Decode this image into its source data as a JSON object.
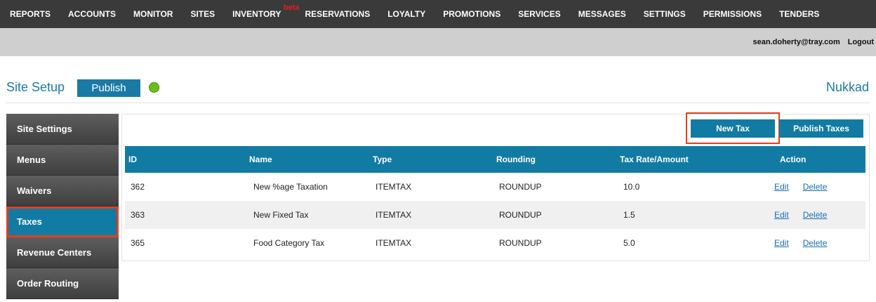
{
  "topnav": {
    "items": [
      "REPORTS",
      "ACCOUNTS",
      "MONITOR",
      "SITES",
      "INVENTORY",
      "RESERVATIONS",
      "LOYALTY",
      "PROMOTIONS",
      "SERVICES",
      "MESSAGES",
      "SETTINGS",
      "PERMISSIONS",
      "TENDERS"
    ],
    "beta_label": "beta"
  },
  "userbar": {
    "email": "sean.doherty@tray.com",
    "logout": "Logout"
  },
  "header": {
    "title": "Site Setup",
    "publish_label": "Publish",
    "site_name": "Nukkad",
    "status_color": "#6bbf1a"
  },
  "sidebar": {
    "items": [
      {
        "label": "Site Settings"
      },
      {
        "label": "Menus"
      },
      {
        "label": "Waivers"
      },
      {
        "label": "Taxes"
      },
      {
        "label": "Revenue Centers"
      },
      {
        "label": "Order Routing"
      }
    ],
    "active_index": 3
  },
  "actions": {
    "new_tax": "New Tax",
    "publish_taxes": "Publish Taxes"
  },
  "table": {
    "headers": [
      "ID",
      "Name",
      "Type",
      "Rounding",
      "Tax Rate/Amount",
      "Action"
    ],
    "rows": [
      {
        "id": "362",
        "name": "New %age Taxation",
        "type": "ITEMTAX",
        "rounding": "ROUNDUP",
        "rate": "10.0",
        "edit": "Edit",
        "delete": "Delete"
      },
      {
        "id": "363",
        "name": "New Fixed Tax",
        "type": "ITEMTAX",
        "rounding": "ROUNDUP",
        "rate": "1.5",
        "edit": "Edit",
        "delete": "Delete"
      },
      {
        "id": "365",
        "name": "Food Category Tax",
        "type": "ITEMTAX",
        "rounding": "ROUNDUP",
        "rate": "5.0",
        "edit": "Edit",
        "delete": "Delete"
      }
    ]
  },
  "colors": {
    "accent": "#127ba3",
    "highlight": "#e04020"
  }
}
